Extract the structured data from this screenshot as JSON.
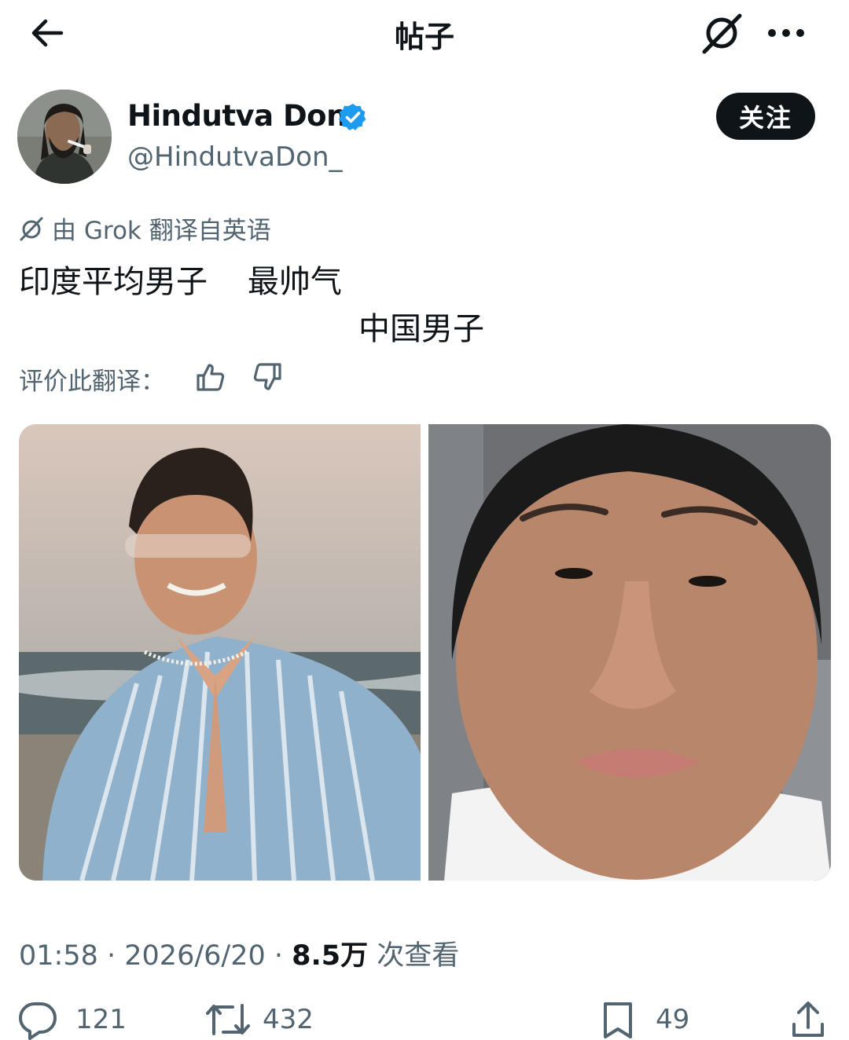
{
  "header": {
    "title": "帖子",
    "back_icon": "arrow-left-icon",
    "grok_icon": "grok-icon",
    "more_icon": "more-horizontal-icon"
  },
  "author": {
    "name": "Hindutva Don",
    "handle": "@HindutvaDon_",
    "verified": true,
    "verified_color": "#1d9bf0",
    "follow_label": "关注"
  },
  "translation": {
    "note": "由 Grok 翻译自英语",
    "line1": "印度平均男子    最帅气",
    "line2": "中国男子",
    "rate_label": "评价此翻译："
  },
  "media": {
    "count": 2
  },
  "meta": {
    "time": "01:58",
    "separator": " · ",
    "date": "2026/6/20",
    "views": "8.5万",
    "views_label": " 次查看"
  },
  "actions": {
    "replies": "121",
    "reposts": "432",
    "bookmarks": "49"
  },
  "colors": {
    "text": "#0f1419",
    "secondary": "#536471",
    "accent": "#1d9bf0"
  }
}
